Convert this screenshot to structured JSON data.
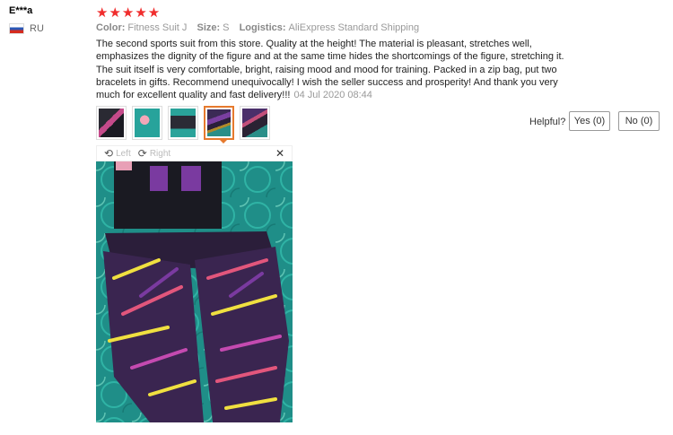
{
  "reviewer": {
    "name": "E***a",
    "country": "RU",
    "flag_icon": "russia-flag-icon"
  },
  "rating": {
    "stars": "★★★★★",
    "value": 5,
    "color": "#f02d2d"
  },
  "meta": {
    "color_label": "Color:",
    "color_value": "Fitness Suit J",
    "size_label": "Size:",
    "size_value": "S",
    "logistics_label": "Logistics:",
    "logistics_value": "AliExpress Standard Shipping"
  },
  "review": {
    "text": "The second sports suit from this store. Quality at the height! The material is pleasant, stretches well, emphasizes the dignity of the figure and at the same time hides the shortcomings of the figure, stretching it. The suit itself is very comfortable, bright, raising mood and mood for training. Packed in a zip bag, put two bracelets in gifts. Recommend unequivocally! I wish the seller success and prosperity! And thank you very much for excellent quality and fast delivery!!!",
    "date": "04 Jul 2020 08:44"
  },
  "thumbnails": {
    "count": 5,
    "active_index": 3
  },
  "helpful": {
    "label": "Helpful?",
    "yes": "Yes (0)",
    "no": "No (0)"
  },
  "viewer": {
    "left_label": "Left",
    "right_label": "Right",
    "close": "✕",
    "rotate_left_icon": "rotate-left-icon",
    "rotate_right_icon": "rotate-right-icon"
  },
  "colors": {
    "accent": "#e67a2e"
  }
}
